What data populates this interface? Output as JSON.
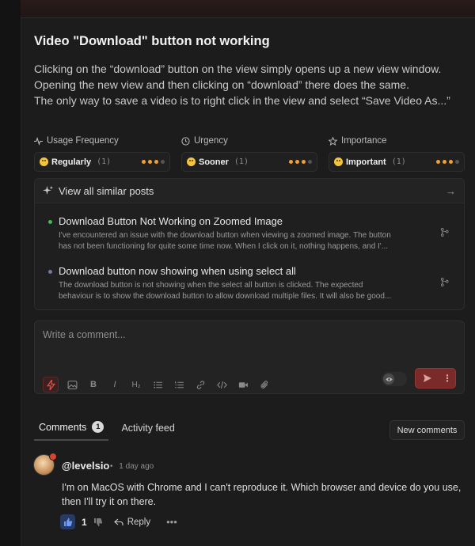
{
  "post": {
    "title": "Video \"Download\" button not working",
    "description": [
      "Clicking on the “download” button on the view simply opens up a new view window.",
      "Opening the new view and then clicking on “download” there does the same.",
      "The only way to save a video is to right click in the view and select “Save Video As...”"
    ]
  },
  "attributes": [
    {
      "label": "Usage Frequency",
      "icon": "activity-icon",
      "value": "Regularly",
      "count": "(1)",
      "level": 3,
      "max": 4
    },
    {
      "label": "Urgency",
      "icon": "clock-icon",
      "value": "Sooner",
      "count": "(1)",
      "level": 3,
      "max": 4
    },
    {
      "label": "Importance",
      "icon": "star-icon",
      "value": "Important",
      "count": "(1)",
      "level": 3,
      "max": 4
    }
  ],
  "similar": {
    "header": "View all similar posts",
    "posts": [
      {
        "title": "Download Button Not Working on Zoomed Image",
        "status_color": "#3fb950",
        "body": [
          "I've encountered an issue with the download button when viewing a zoomed image. The button",
          "has not been functioning for quite some time now. When I click on it, nothing happens, and I'..."
        ]
      },
      {
        "title": "Download button now showing when using select all",
        "status_color": "#6e7ba8",
        "body": [
          "The download button is not showing when the select all button is clicked. The expected",
          "behaviour is to show the download button to allow download multiple files. It will also be good..."
        ]
      }
    ]
  },
  "composer": {
    "placeholder": "Write a comment...",
    "tools": [
      "lightning-icon",
      "image-icon",
      "bold-icon",
      "italic-icon",
      "heading-icon",
      "bullet-list-icon",
      "numbered-list-icon",
      "link-icon",
      "code-icon",
      "video-icon",
      "attachment-icon"
    ]
  },
  "tabs": {
    "comments_label": "Comments",
    "comments_count": "1",
    "activity_label": "Activity feed",
    "new_comments_label": "New comments"
  },
  "comment": {
    "user": "@levelsio",
    "separator": "•",
    "time": "1 day ago",
    "text": [
      "I'm on MacOS with Chrome and I can't reproduce it. Which browser and device do you use,",
      "then I'll try it on there."
    ],
    "likes": "1",
    "reply_label": "Reply",
    "more_label": "•••"
  },
  "colors": {
    "accent": "#e34a3b",
    "dots_on": "#f0a030",
    "dots_off": "#555555"
  }
}
